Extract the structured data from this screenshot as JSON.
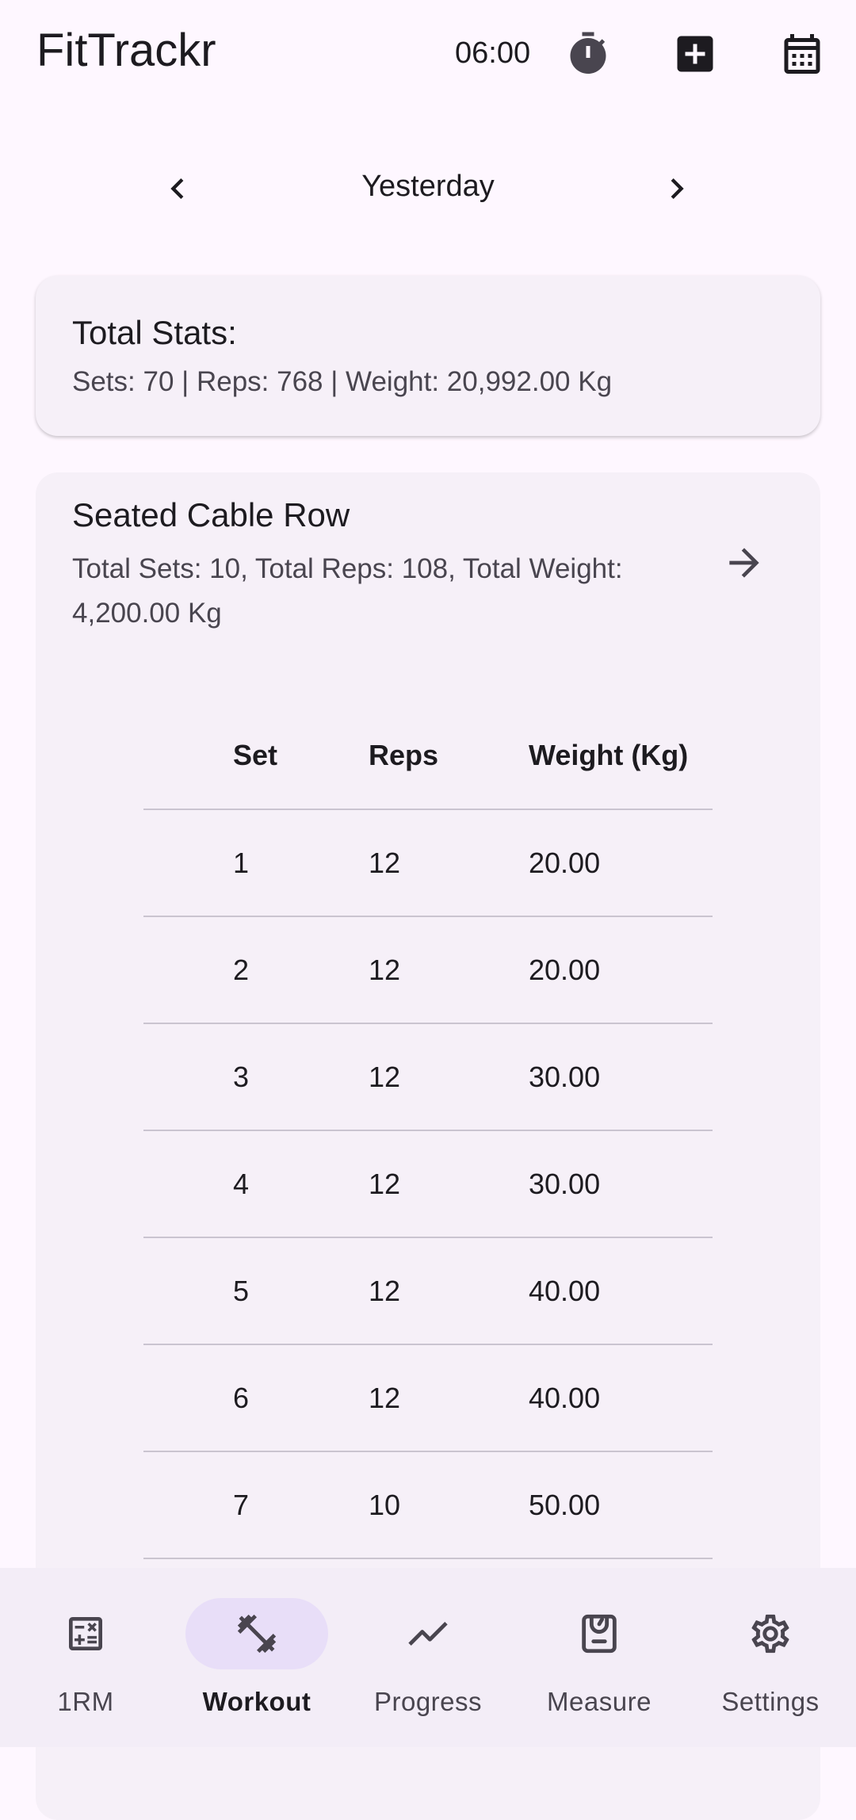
{
  "app": {
    "title": "FitTrackr",
    "timer": "06:00",
    "actions": [
      {
        "name": "timer",
        "icon": "stopwatch-icon"
      },
      {
        "name": "add",
        "icon": "add-box-icon"
      },
      {
        "name": "calendar",
        "icon": "calendar-icon"
      }
    ]
  },
  "date_nav": {
    "label": "Yesterday",
    "prev_icon": "chevron-left-icon",
    "next_icon": "chevron-right-icon"
  },
  "stats": {
    "title": "Total Stats:",
    "summary": "Sets: 70 | Reps: 768 | Weight: 20,992.00 Kg"
  },
  "exercise": {
    "title": "Seated Cable Row",
    "summary": "Total Sets: 10, Total Reps: 108, Total Weight: 4,200.00 Kg",
    "open_icon": "arrow-right-icon",
    "columns": [
      "Set",
      "Reps",
      "Weight (Kg)"
    ],
    "rows": [
      [
        "1",
        "12",
        "20.00"
      ],
      [
        "2",
        "12",
        "20.00"
      ],
      [
        "3",
        "12",
        "30.00"
      ],
      [
        "4",
        "12",
        "30.00"
      ],
      [
        "5",
        "12",
        "40.00"
      ],
      [
        "6",
        "12",
        "40.00"
      ],
      [
        "7",
        "10",
        "50.00"
      ]
    ]
  },
  "bottom_nav": {
    "active": "Workout",
    "items": [
      {
        "label": "1RM",
        "icon": "calculator-icon"
      },
      {
        "label": "Workout",
        "icon": "dumbbell-icon"
      },
      {
        "label": "Progress",
        "icon": "trending-line-icon"
      },
      {
        "label": "Measure",
        "icon": "scale-icon"
      },
      {
        "label": "Settings",
        "icon": "gear-icon"
      }
    ]
  },
  "colors": {
    "background": "#fef7ff",
    "card": "#f6f0f8",
    "nav_bar": "#f3edf7",
    "active_pill": "#e8def8",
    "icon": "#49454f"
  }
}
